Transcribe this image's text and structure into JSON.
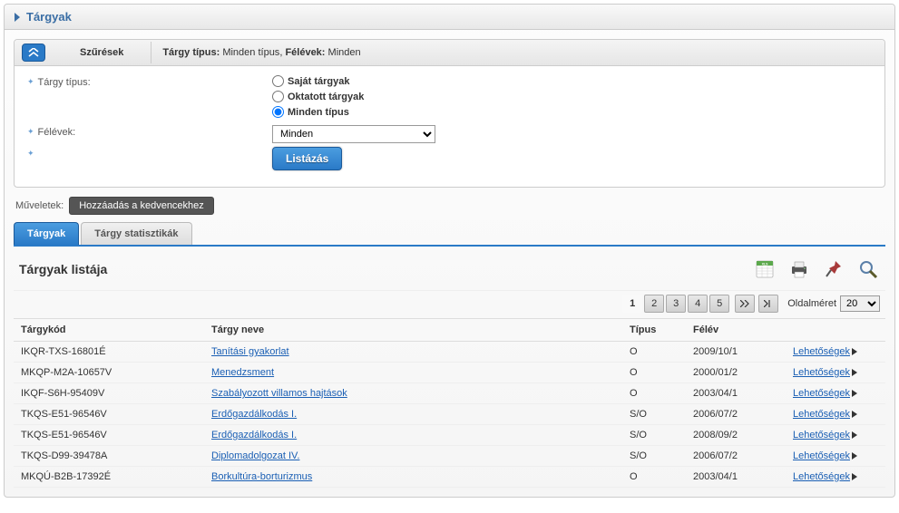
{
  "header": {
    "title": "Tárgyak"
  },
  "filters": {
    "title": "Szűrések",
    "summary_label_type": "Tárgy típus:",
    "summary_value_type": "Minden típus",
    "summary_label_sem": "Félévek:",
    "summary_value_sem": "Minden",
    "type_label": "Tárgy típus:",
    "type_options": [
      "Saját tárgyak",
      "Oktatott tárgyak",
      "Minden típus"
    ],
    "type_selected": "Minden típus",
    "semester_label": "Félévek:",
    "semester_value": "Minden",
    "list_button": "Listázás"
  },
  "operations": {
    "label": "Műveletek:",
    "add_favorite": "Hozzáadás a kedvencekhez"
  },
  "tabs": [
    {
      "label": "Tárgyak",
      "active": true
    },
    {
      "label": "Tárgy statisztikák",
      "active": false
    }
  ],
  "list": {
    "title": "Tárgyak listája",
    "columns": {
      "code": "Tárgykód",
      "name": "Tárgy neve",
      "type": "Típus",
      "semester": "Félév",
      "action": "Lehetőségek"
    },
    "rows": [
      {
        "code": "IKQR-TXS-16801É",
        "name": "Tanítási gyakorlat",
        "type": "O",
        "semester": "2009/10/1"
      },
      {
        "code": "MKQP-M2A-10657V",
        "name": "Menedzsment",
        "type": "O",
        "semester": "2000/01/2"
      },
      {
        "code": "IKQF-S6H-95409V",
        "name": "Szabályozott villamos hajtások",
        "type": "O",
        "semester": "2003/04/1"
      },
      {
        "code": "TKQS-E51-96546V",
        "name": "Erdőgazdálkodás I.",
        "type": "S/O",
        "semester": "2006/07/2"
      },
      {
        "code": "TKQS-E51-96546V",
        "name": "Erdőgazdálkodás I.",
        "type": "S/O",
        "semester": "2008/09/2"
      },
      {
        "code": "TKQS-D99-39478A",
        "name": "Diplomadolgozat IV.",
        "type": "S/O",
        "semester": "2006/07/2"
      },
      {
        "code": "MKQÚ-B2B-17392É",
        "name": "Borkultúra-borturizmus",
        "type": "O",
        "semester": "2003/04/1"
      }
    ]
  },
  "pager": {
    "pages": [
      "1",
      "2",
      "3",
      "4",
      "5"
    ],
    "current": "1",
    "size_label": "Oldalméret",
    "size_value": "20"
  }
}
